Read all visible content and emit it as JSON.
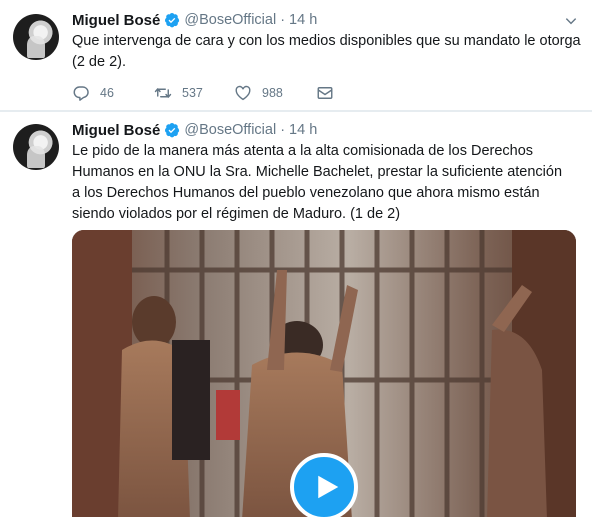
{
  "colors": {
    "accent": "#1da1f2",
    "muted": "#657786",
    "text": "#14171a"
  },
  "tweets": [
    {
      "name": "Miguel Bosé",
      "handle": "@BoseOfficial",
      "separator": "·",
      "time": "14 h",
      "text": "Que intervenga de cara y con los medios disponibles que su mandato le otorga (2 de 2).",
      "replies": "46",
      "retweets": "537",
      "likes": "988"
    },
    {
      "name": "Miguel Bosé",
      "handle": "@BoseOfficial",
      "separator": "·",
      "time": "14 h",
      "text": "Le pido de la manera más atenta a la alta comisionada de los Derechos Humanos en la ONU la Sra. Michelle Bachelet, prestar la suficiente atención a los Derechos Humanos del pueblo venezolano que ahora mismo están siendo violados por el régimen de Maduro. (1 de 2)"
    }
  ],
  "icons": {
    "verified": "verified-badge-icon",
    "caret": "chevron-down-icon",
    "reply": "reply-icon",
    "retweet": "retweet-icon",
    "like": "heart-icon",
    "message": "direct-message-icon",
    "play": "play-icon"
  }
}
